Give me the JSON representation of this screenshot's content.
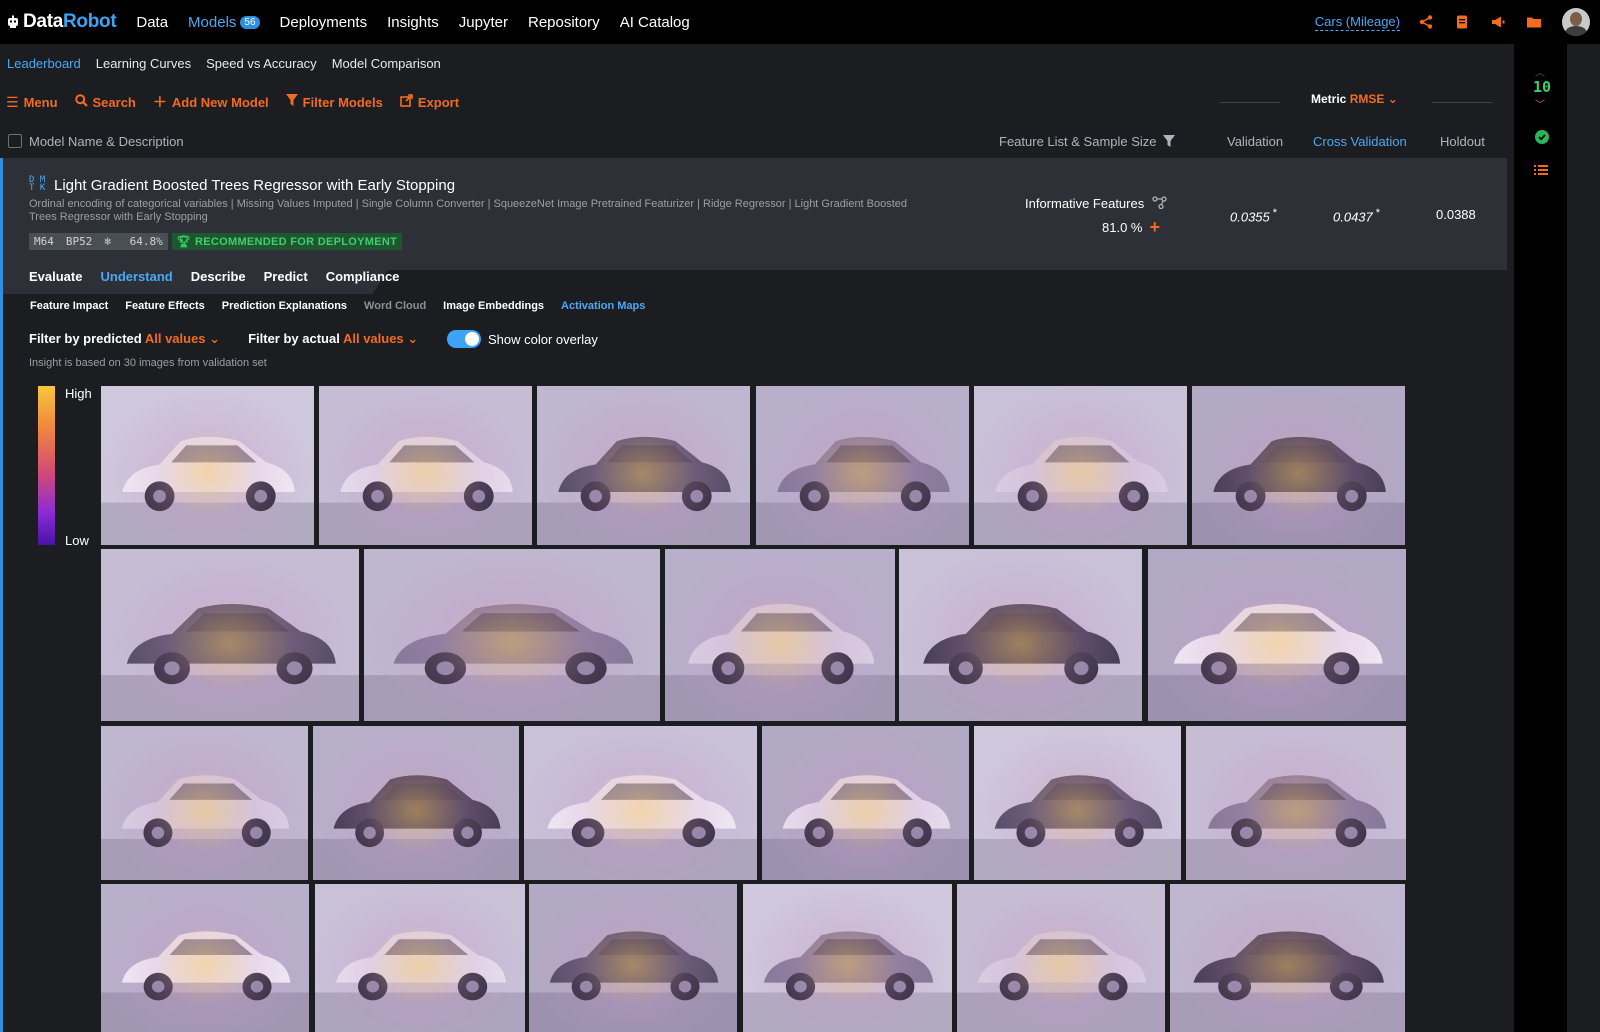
{
  "nav": {
    "brand_left": "Data",
    "brand_right": "Robot",
    "items": [
      {
        "label": "Data"
      },
      {
        "label": "Models",
        "badge": "56"
      },
      {
        "label": "Deployments"
      },
      {
        "label": "Insights"
      },
      {
        "label": "Jupyter"
      },
      {
        "label": "Repository"
      },
      {
        "label": "AI Catalog"
      }
    ],
    "project": "Cars (Mileage)"
  },
  "subtabs": [
    "Leaderboard",
    "Learning Curves",
    "Speed vs Accuracy",
    "Model Comparison"
  ],
  "toolbar": {
    "menu": "Menu",
    "search": "Search",
    "add": "Add New Model",
    "filter": "Filter Models",
    "export": "Export",
    "metric_label": "Metric",
    "metric_value": "RMSE"
  },
  "columns": {
    "name": "Model Name & Description",
    "feature": "Feature List & Sample Size",
    "validation": "Validation",
    "cross_validation": "Cross Validation",
    "holdout": "Holdout"
  },
  "model": {
    "title": "Light Gradient Boosted Trees Regressor with Early Stopping",
    "description": "Ordinal encoding of categorical variables | Missing Values Imputed | Single Column Converter | SqueezeNet Image Pretrained Featurizer | Ridge Regressor | Light Gradient Boosted Trees Regressor with Early Stopping",
    "tag_m": "M64",
    "tag_bp": "BP52",
    "tag_pct": "64.8%",
    "recommended": "RECOMMENDED FOR DEPLOYMENT",
    "feature_list": "Informative Features",
    "sample_pct": "81.0 %",
    "validation": "0.0355",
    "cross_validation": "0.0437",
    "holdout": "0.0388",
    "asterisk": "*"
  },
  "insight_tabs": [
    "Evaluate",
    "Understand",
    "Describe",
    "Predict",
    "Compliance"
  ],
  "insight_subtabs": [
    "Feature Impact",
    "Feature Effects",
    "Prediction Explanations",
    "Word Cloud",
    "Image Embeddings",
    "Activation Maps"
  ],
  "filters": {
    "pred_label": "Filter by predicted",
    "pred_value": "All values",
    "actual_label": "Filter by actual",
    "actual_value": "All values",
    "overlay_label": "Show color overlay",
    "overlay_on": true
  },
  "note": "Insight is based on 30 images from validation set",
  "legend": {
    "high": "High",
    "low": "Low"
  },
  "rail": {
    "count": "10"
  },
  "colors": {
    "accent": "#f26b21",
    "link": "#49a9f3",
    "success": "#3ecf6d"
  }
}
